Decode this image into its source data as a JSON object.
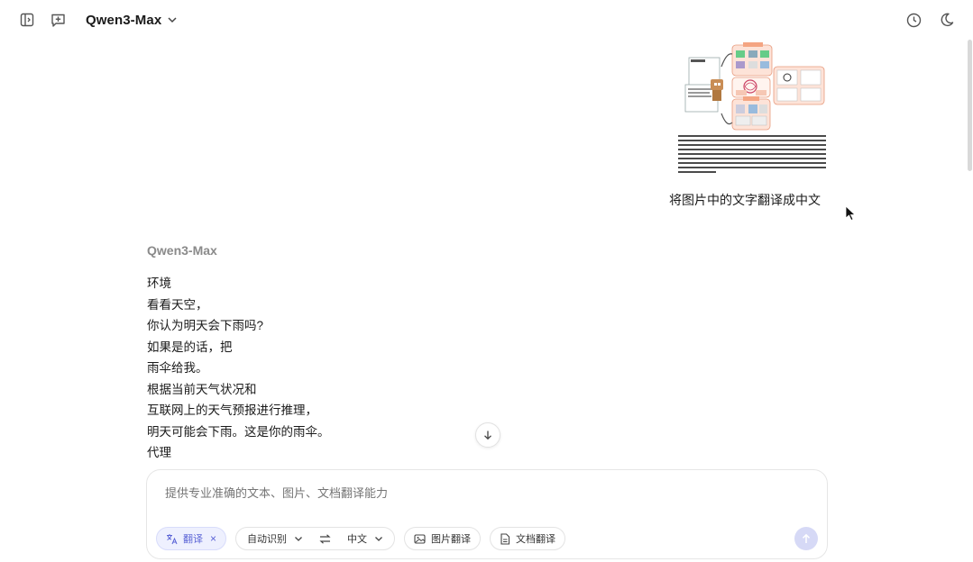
{
  "header": {
    "model_name": "Qwen3-Max",
    "icons": [
      "sidebar-toggle-icon",
      "new-chat-icon",
      "chevron-down-icon",
      "history-icon",
      "moon-icon"
    ]
  },
  "user_message": {
    "text": "将图片中的文字翻译成中文"
  },
  "assistant": {
    "name": "Qwen3-Max",
    "lines": [
      "环境",
      "看看天空，",
      "你认为明天会下雨吗?",
      "如果是的话，把",
      "雨伞给我。",
      "根据当前天气状况和",
      "互联网上的天气预报进行推理，",
      "明天可能会下雨。这是你的雨伞。",
      "代理"
    ]
  },
  "composer": {
    "placeholder": "提供专业准确的文本、图片、文档翻译能力",
    "translate_chip": "翻译",
    "source_language": "自动识别",
    "target_language": "中文",
    "image_translate": "图片翻译",
    "doc_translate": "文档翻译"
  },
  "colors": {
    "accent": "#5b64d6",
    "chip_active_bg": "#eef0fe",
    "send_button": "#d6d9f6"
  }
}
